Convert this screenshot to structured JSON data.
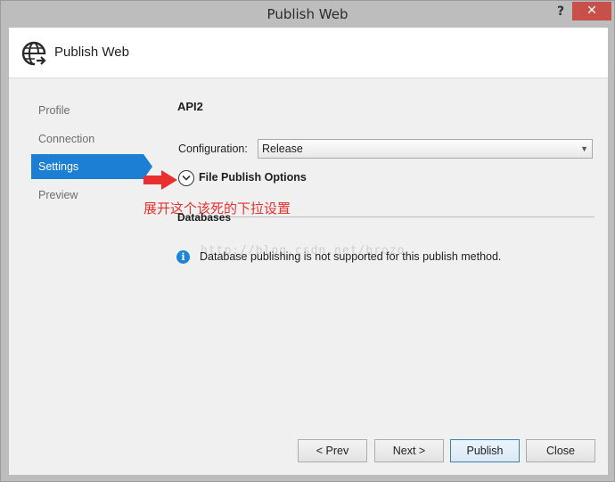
{
  "window": {
    "title": "Publish Web",
    "help_glyph": "?",
    "close_glyph": "✕"
  },
  "header": {
    "icon": "globe-publish-icon",
    "title": "Publish Web"
  },
  "nav": {
    "items": [
      {
        "label": "Profile",
        "active": false
      },
      {
        "label": "Connection",
        "active": false
      },
      {
        "label": "Settings",
        "active": true
      },
      {
        "label": "Preview",
        "active": false
      }
    ]
  },
  "settings": {
    "profile_name": "API2",
    "configuration_label": "Configuration:",
    "configuration_value": "Release",
    "file_publish_options_label": "File Publish Options",
    "databases_label": "Databases",
    "info_message": "Database publishing is not supported for this publish method."
  },
  "annotation": {
    "text": "展开这个该死的下拉设置",
    "color": "#e83030"
  },
  "watermark": {
    "text": "http://blog.csdn.net/hrozo"
  },
  "buttons": {
    "prev": "< Prev",
    "next": "Next >",
    "publish": "Publish",
    "close": "Close"
  },
  "colors": {
    "accent": "#1d7fd4",
    "close_button": "#c7504a",
    "info": "#1d85d8"
  }
}
